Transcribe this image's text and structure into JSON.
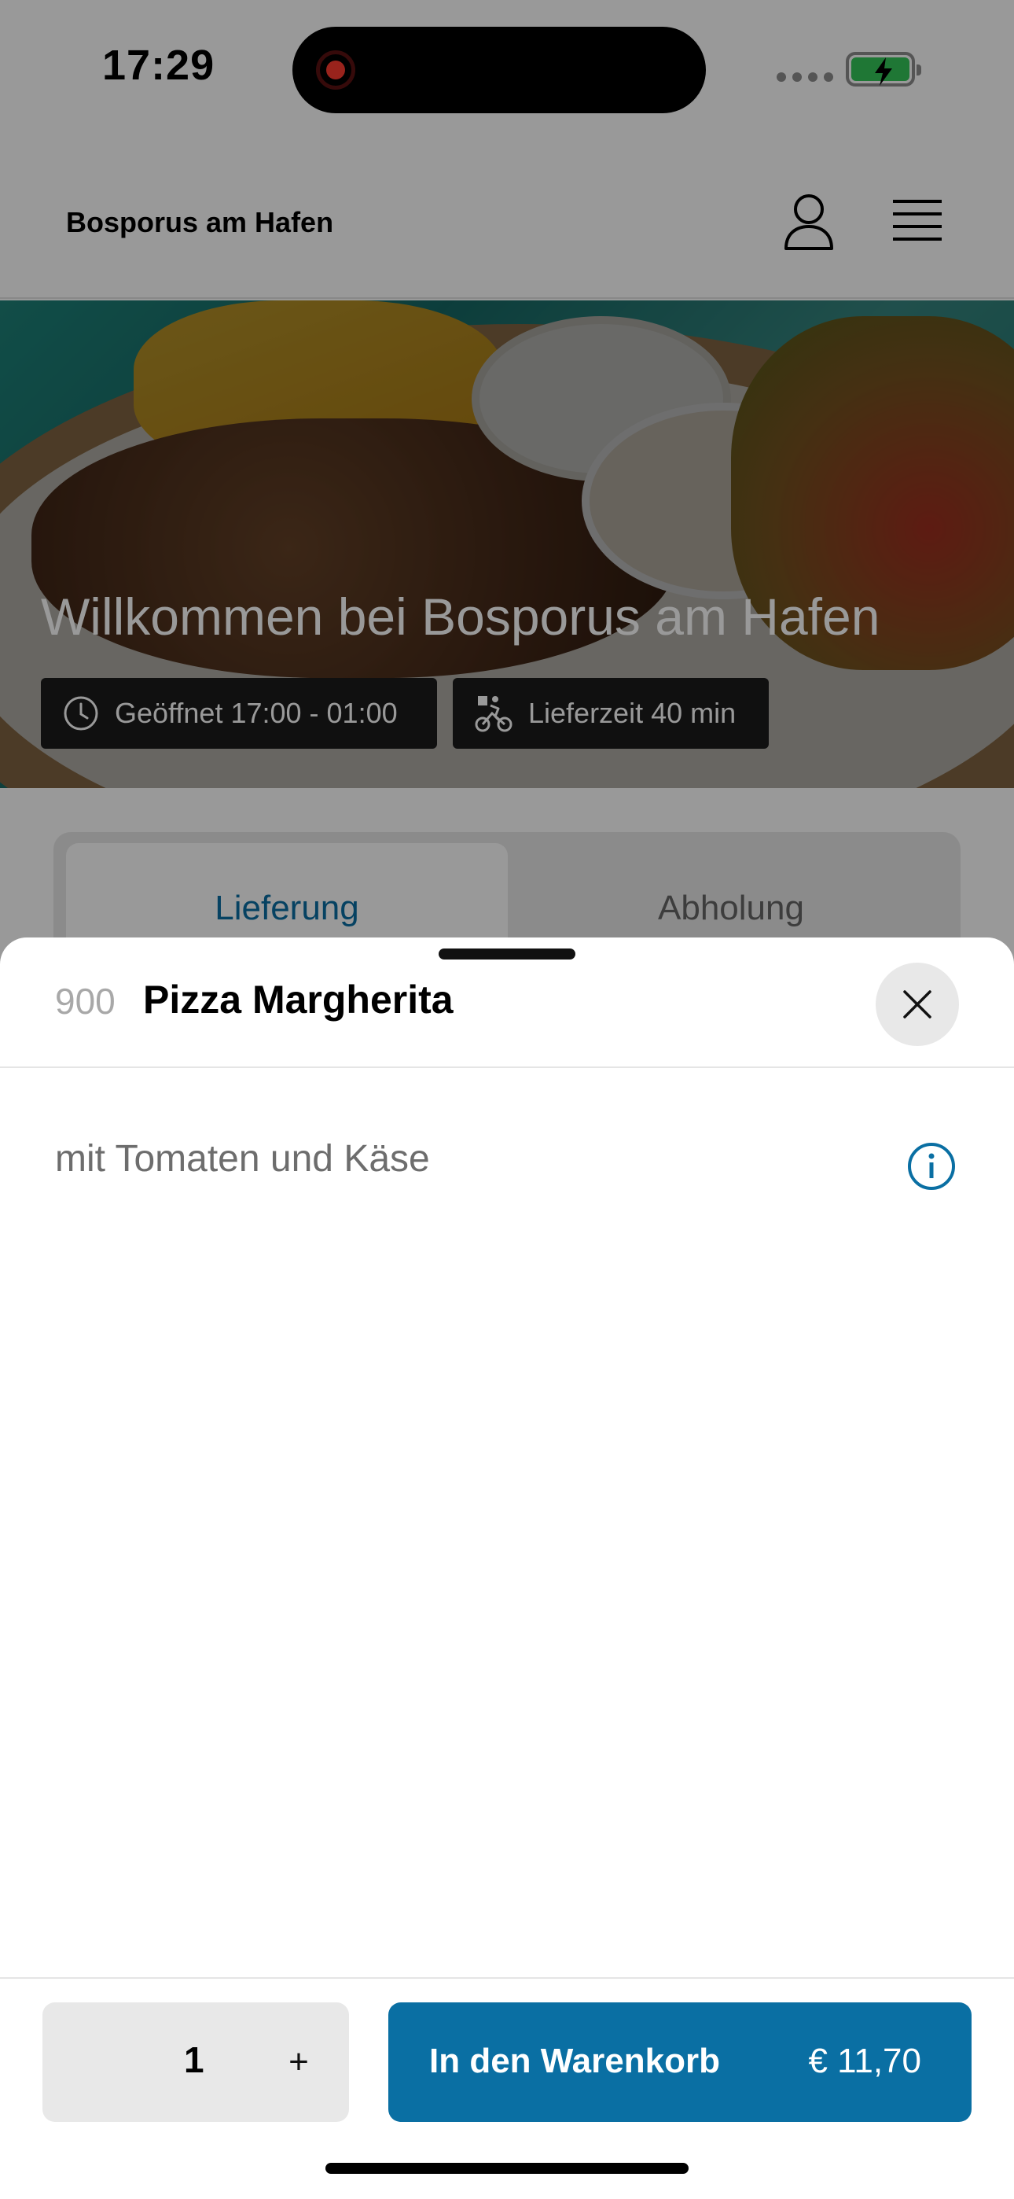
{
  "status_bar": {
    "time": "17:29"
  },
  "header": {
    "restaurant_name": "Bosporus am Hafen",
    "icons": [
      "user-icon",
      "menu-icon"
    ]
  },
  "hero": {
    "title": "Willkommen bei Bosporus am Hafen",
    "opening_hours": "Geöffnet 17:00 - 01:00",
    "delivery_time": "Lieferzeit 40 min"
  },
  "tabs": [
    {
      "label": "Lieferung",
      "active": true
    },
    {
      "label": "Abholung",
      "active": false
    }
  ],
  "item_sheet": {
    "number": "900",
    "name": "Pizza Margherita",
    "description": "mit Tomaten und Käse"
  },
  "footer": {
    "quantity": "1",
    "plus_label": "+",
    "add_to_cart_label": "In den Warenkorb",
    "price": "€ 11,70"
  },
  "colors": {
    "accent": "#0a6fa3",
    "overlay": "rgba(0,0,0,0.40)"
  }
}
